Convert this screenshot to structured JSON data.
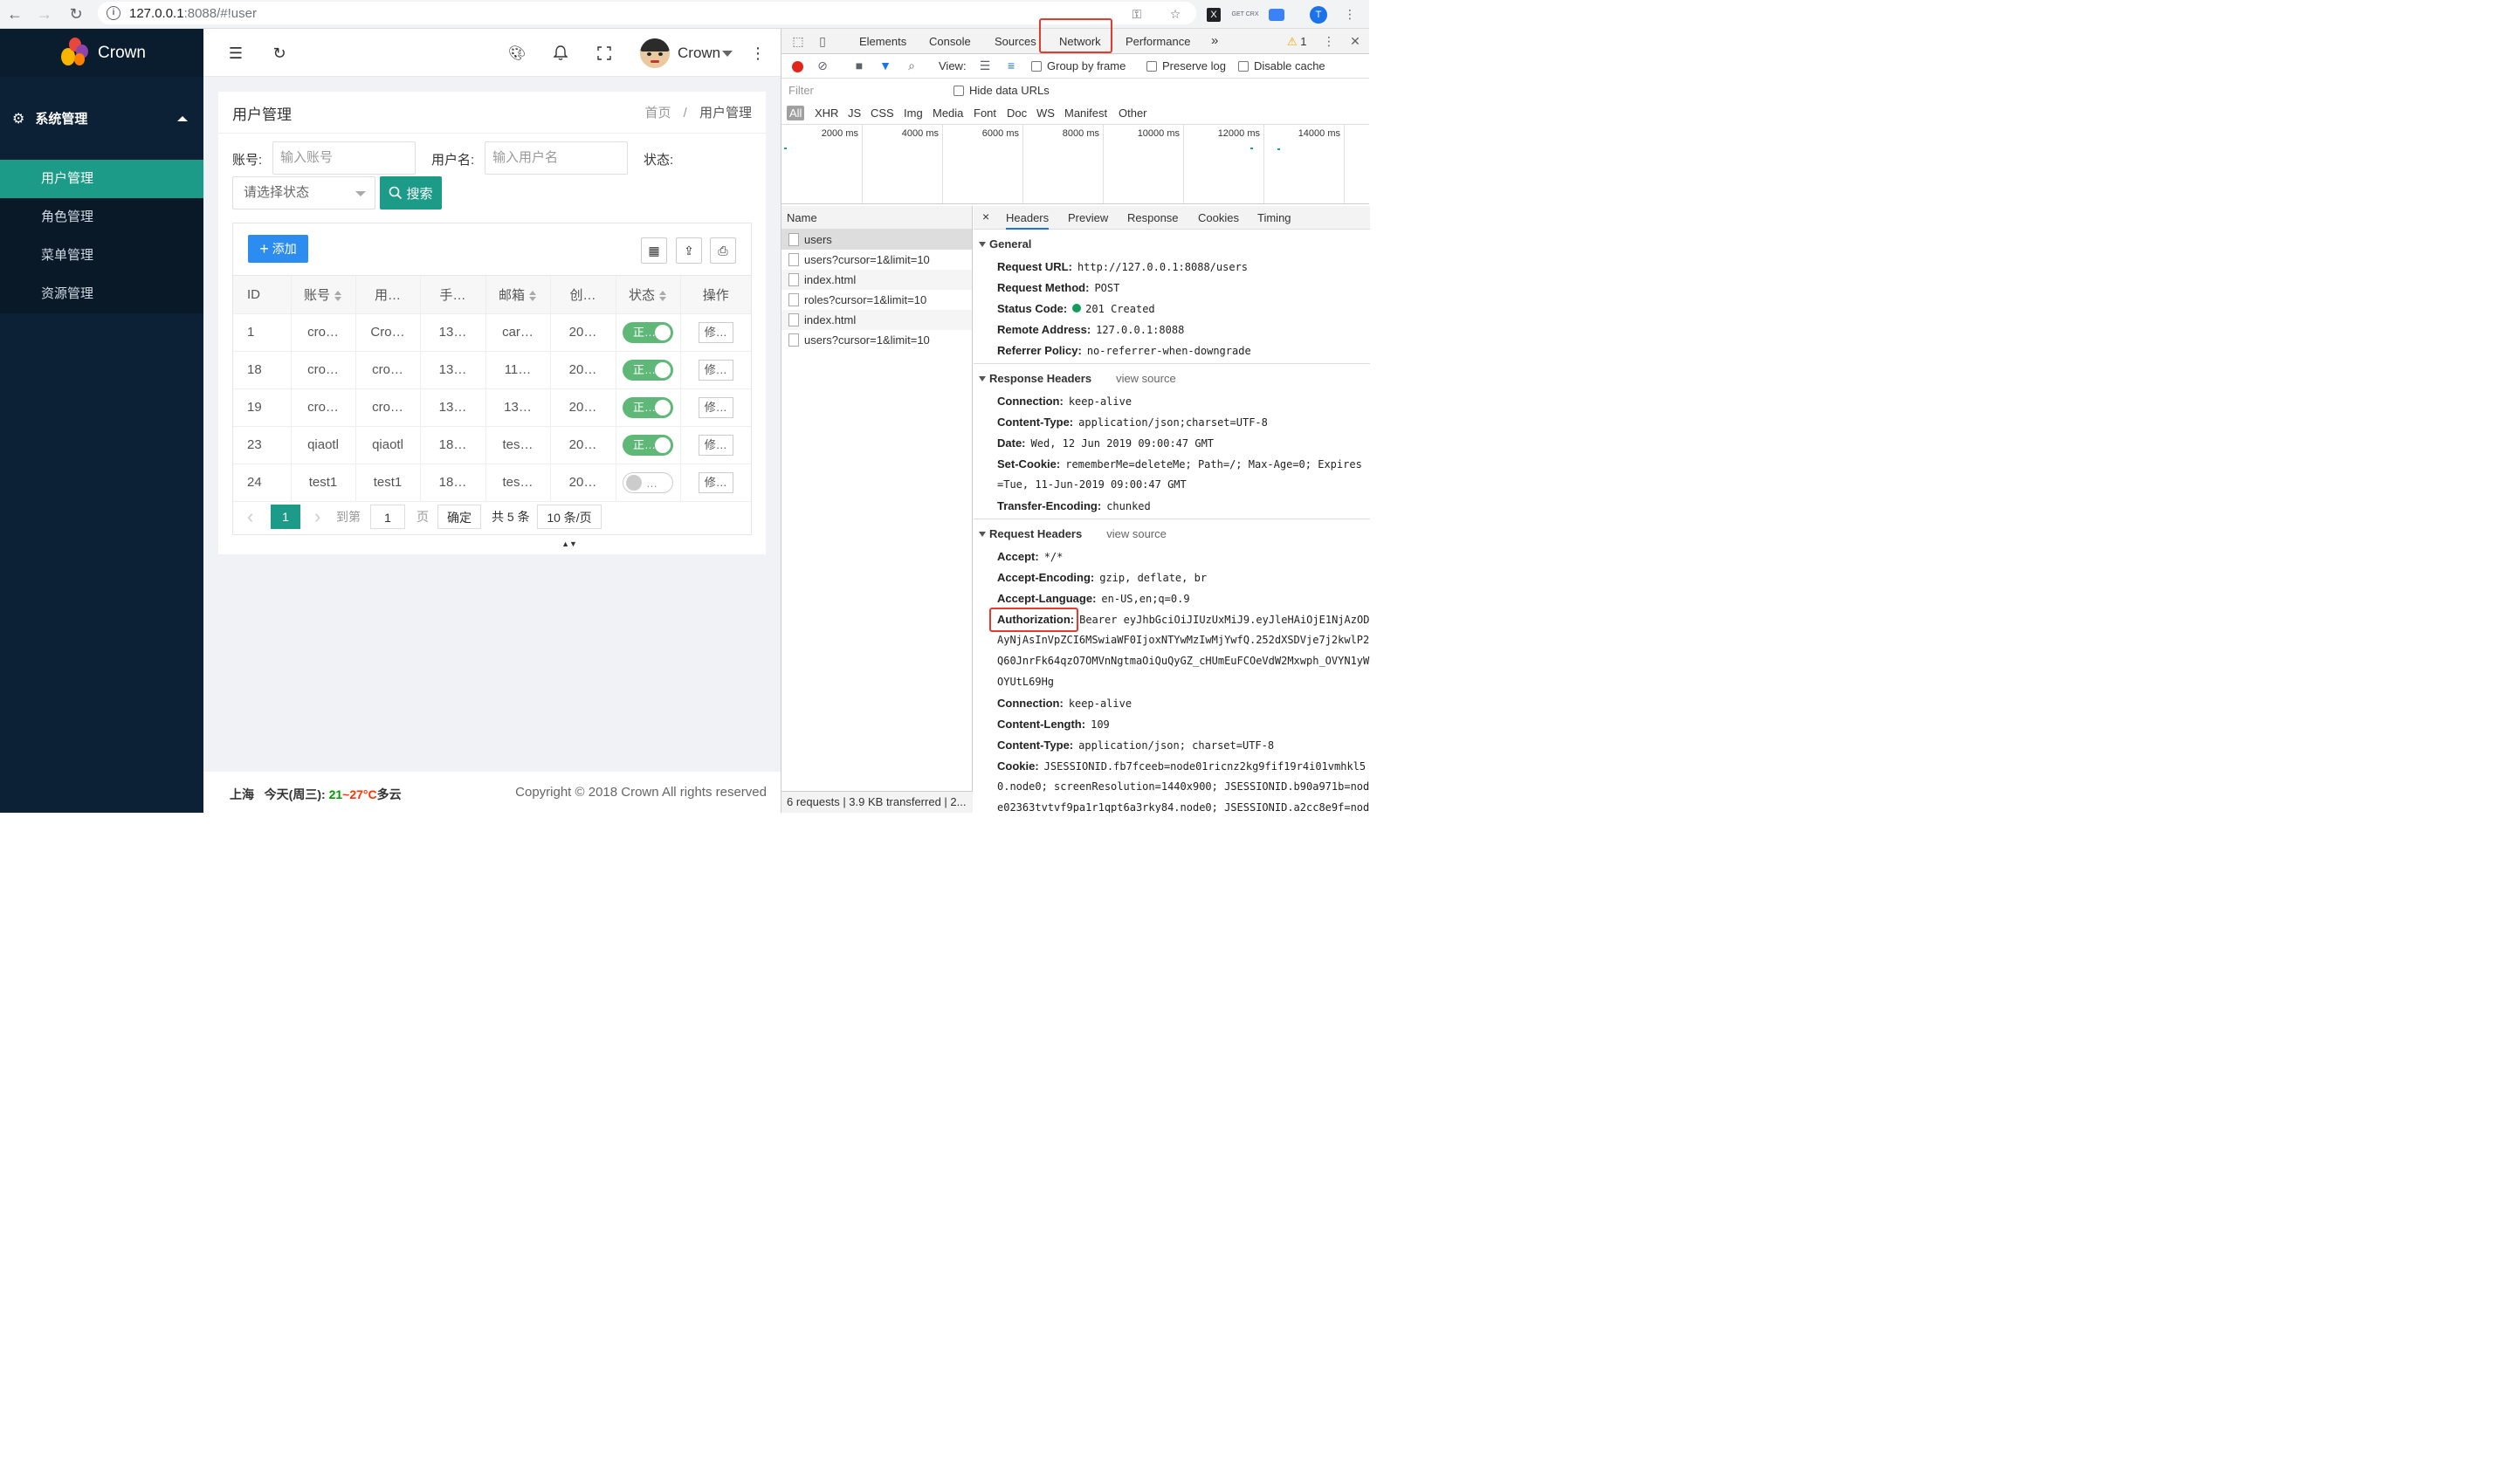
{
  "browser": {
    "url_host": "127.0.0.1",
    "url_rest": ":8088/#!user",
    "ext_x": "X",
    "ext_crx": "GET CRX",
    "profile_initial": "T"
  },
  "app": {
    "brand": "Crown",
    "menu_group": "系统管理",
    "menu_items": [
      "用户管理",
      "角色管理",
      "菜单管理",
      "资源管理"
    ],
    "user_name": "Crown"
  },
  "page": {
    "title": "用户管理",
    "breadcrumb_home": "首页",
    "breadcrumb_sep": "/",
    "breadcrumb_current": "用户管理"
  },
  "filters": {
    "account_label": "账号:",
    "account_placeholder": "输入账号",
    "username_label": "用户名:",
    "username_placeholder": "输入用户名",
    "status_label": "状态:",
    "status_placeholder": "请选择状态",
    "search_label": "搜索"
  },
  "table": {
    "add_label": "添加",
    "columns": [
      "ID",
      "账号",
      "用…",
      "手…",
      "邮箱",
      "创…",
      "状态",
      "操作"
    ],
    "rows": [
      {
        "id": "1",
        "account": "cro…",
        "username": "Cro…",
        "phone": "13…",
        "email": "car…",
        "created": "20…",
        "status": "正…",
        "on": true,
        "action": "修…"
      },
      {
        "id": "18",
        "account": "cro…",
        "username": "cro…",
        "phone": "13…",
        "email": "11…",
        "created": "20…",
        "status": "正…",
        "on": true,
        "action": "修…"
      },
      {
        "id": "19",
        "account": "cro…",
        "username": "cro…",
        "phone": "13…",
        "email": "13…",
        "created": "20…",
        "status": "正…",
        "on": true,
        "action": "修…"
      },
      {
        "id": "23",
        "account": "qiaotl",
        "username": "qiaotl",
        "phone": "18…",
        "email": "tes…",
        "created": "20…",
        "status": "正…",
        "on": true,
        "action": "修…"
      },
      {
        "id": "24",
        "account": "test1",
        "username": "test1",
        "phone": "18…",
        "email": "tes…",
        "created": "20…",
        "status": "…",
        "on": false,
        "action": "修…"
      }
    ]
  },
  "pager": {
    "prev": "‹",
    "current": "1",
    "next": "›",
    "goto_label": "到第",
    "goto_value": "1",
    "page_label": "页",
    "confirm": "确定",
    "total": "共 5 条",
    "page_size": "10 条/页"
  },
  "footer": {
    "city": "上海",
    "today": "今天(周三):",
    "low": "21",
    "range_sep": "~",
    "high": "27°C",
    "condition": "多云",
    "copyright": "Copyright © 2018 Crown All rights reserved"
  },
  "devtools": {
    "tabs": [
      "Elements",
      "Console",
      "Sources",
      "Network",
      "Performance"
    ],
    "more": "»",
    "warnings": "1",
    "view_label": "View:",
    "group_by_frame": "Group by frame",
    "preserve_log": "Preserve log",
    "disable_cache": "Disable cache",
    "filter_placeholder": "Filter",
    "hide_data_urls": "Hide data URLs",
    "types": [
      "All",
      "XHR",
      "JS",
      "CSS",
      "Img",
      "Media",
      "Font",
      "Doc",
      "WS",
      "Manifest",
      "Other"
    ],
    "timeline": [
      "2000 ms",
      "4000 ms",
      "6000 ms",
      "8000 ms",
      "10000 ms",
      "12000 ms",
      "14000 ms"
    ],
    "name_header": "Name",
    "requests": [
      "users",
      "users?cursor=1&limit=10",
      "index.html",
      "roles?cursor=1&limit=10",
      "index.html",
      "users?cursor=1&limit=10"
    ],
    "status_bar": "6 requests | 3.9 KB transferred | 2...",
    "detail_tabs": [
      "Headers",
      "Preview",
      "Response",
      "Cookies",
      "Timing"
    ],
    "general_title": "General",
    "general": [
      {
        "k": "Request URL:",
        "v": "http://127.0.0.1:8088/users"
      },
      {
        "k": "Request Method:",
        "v": "POST"
      },
      {
        "k": "Status Code:",
        "v": "201 Created"
      },
      {
        "k": "Remote Address:",
        "v": "127.0.0.1:8088"
      },
      {
        "k": "Referrer Policy:",
        "v": "no-referrer-when-downgrade"
      }
    ],
    "response_title": "Response Headers",
    "view_source": "view source",
    "response": [
      {
        "k": "Connection:",
        "v": "keep-alive"
      },
      {
        "k": "Content-Type:",
        "v": "application/json;charset=UTF-8"
      },
      {
        "k": "Date:",
        "v": "Wed, 12 Jun 2019 09:00:47 GMT"
      },
      {
        "k": "Set-Cookie:",
        "v": "rememberMe=deleteMe; Path=/; Max-Age=0; Expires"
      },
      {
        "k": "",
        "v": "=Tue, 11-Jun-2019 09:00:47 GMT"
      },
      {
        "k": "Transfer-Encoding:",
        "v": "chunked"
      }
    ],
    "request_title": "Request Headers",
    "request": [
      {
        "k": "Accept:",
        "v": "*/*"
      },
      {
        "k": "Accept-Encoding:",
        "v": "gzip, deflate, br"
      },
      {
        "k": "Accept-Language:",
        "v": "en-US,en;q=0.9"
      },
      {
        "k": "Authorization:",
        "v": "Bearer eyJhbGciOiJIUzUxMiJ9.eyJleHAiOjE1NjAzOD"
      },
      {
        "k": "",
        "v": "AyNjAsInVpZCI6MSwiaWF0IjoxNTYwMzIwMjYwfQ.252dXSDVje7j2kwlP2"
      },
      {
        "k": "",
        "v": "Q60JnrFk64qzO7OMVnNgtmaOiQuQyGZ_cHUmEuFCOeVdW2Mxwph_OVYN1yW"
      },
      {
        "k": "",
        "v": "OYUtL69Hg"
      },
      {
        "k": "Connection:",
        "v": "keep-alive"
      },
      {
        "k": "Content-Length:",
        "v": "109"
      },
      {
        "k": "Content-Type:",
        "v": "application/json; charset=UTF-8"
      },
      {
        "k": "Cookie:",
        "v": "JSESSIONID.fb7fceeb=node01ricnz2kg9fif19r4i01vmhkl5"
      },
      {
        "k": "",
        "v": "0.node0; screenResolution=1440x900; JSESSIONID.b90a971b=nod"
      },
      {
        "k": "",
        "v": "e02363tvtvf9pa1r1qpt6a3rky84.node0; JSESSIONID.a2cc8e9f=nod"
      }
    ]
  }
}
